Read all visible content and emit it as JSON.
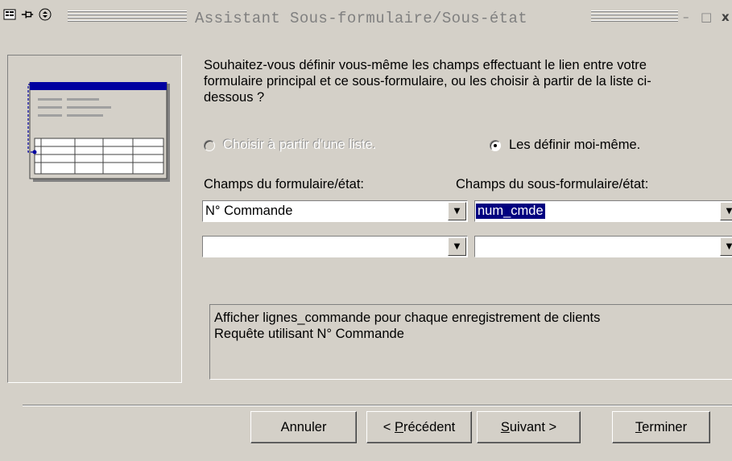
{
  "window": {
    "title": "Assistant Sous-formulaire/Sous-état",
    "minimize_glyph": "–",
    "maximize_glyph": "□",
    "close_glyph": "x"
  },
  "question": "Souhaitez-vous définir vous-même les champs effectuant le lien entre votre\nformulaire principal et ce sous-formulaire, ou les choisir à partir de la liste ci-\ndessous ?",
  "options": {
    "from_list": {
      "label": "Choisir à partir d'une liste.",
      "selected": false,
      "enabled": false
    },
    "define_myself": {
      "label": "Les définir moi-même.",
      "selected": true,
      "enabled": true
    }
  },
  "main_fields": {
    "label": "Champs du formulaire/état:",
    "row1_value": "N° Commande",
    "row2_value": ""
  },
  "sub_fields": {
    "label": "Champs du sous-formulaire/état:",
    "row1_value": "num_cmde",
    "row2_value": ""
  },
  "description": {
    "line1": "Afficher lignes_commande pour chaque enregistrement de clients",
    "line2": "Requête utilisant N° Commande"
  },
  "buttons": {
    "cancel": "Annuler",
    "back_prefix": "< ",
    "back_key": "P",
    "back_rest": "récédent",
    "next_key": "S",
    "next_rest": "uivant >",
    "finish_key": "T",
    "finish_rest": "erminer"
  },
  "colors": {
    "face": "#d4d0c8",
    "selection": "#000080",
    "diagram_accent": "#0000a0"
  }
}
